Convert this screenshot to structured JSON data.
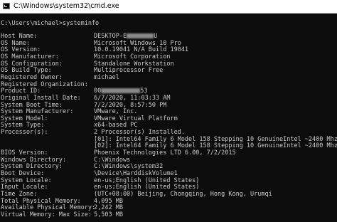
{
  "window": {
    "title": "C:\\Windows\\system32\\cmd.exe",
    "icon": "cmd-app-icon"
  },
  "console": {
    "prompt": "C:\\Users\\michael>systeminfo",
    "rows": [
      {
        "label": "Host Name:",
        "value": "DESKTOP-E",
        "tail": "U",
        "redacted": true
      },
      {
        "label": "OS Name:",
        "value": "Microsoft Windows 10 Pro"
      },
      {
        "label": "OS Version:",
        "value": "10.0.19041 N/A Build 19041"
      },
      {
        "label": "OS Manufacturer:",
        "value": "Microsoft Corporation"
      },
      {
        "label": "OS Configuration:",
        "value": "Standalone Workstation"
      },
      {
        "label": "OS Build Type:",
        "value": "Multiprocessor Free"
      },
      {
        "label": "Registered Owner:",
        "value": "michael"
      },
      {
        "label": "Registered Organization:",
        "value": ""
      },
      {
        "label": "Product ID:",
        "value": "00",
        "tail": "53",
        "redacted": true
      },
      {
        "label": "Original Install Date:",
        "value": "6/7/2020, 11:03:33 AM"
      },
      {
        "label": "System Boot Time:",
        "value": "7/2/2020, 8:57:50 PM"
      },
      {
        "label": "System Manufacturer:",
        "value": "VMware, Inc."
      },
      {
        "label": "System Model:",
        "value": "VMware Virtual Platform"
      },
      {
        "label": "System Type:",
        "value": "x64-based PC"
      },
      {
        "label": "Processor(s):",
        "value": "2 Processor(s) Installed."
      },
      {
        "label": "",
        "value": "[01]: Intel64 Family 6 Model 158 Stepping 10 GenuineIntel ~2400 Mhz"
      },
      {
        "label": "",
        "value": "[02]: Intel64 Family 6 Model 158 Stepping 10 GenuineIntel ~2400 Mhz"
      },
      {
        "label": "BIOS Version:",
        "value": "Phoenix Technologies LTD 6.00, 7/2/2015"
      },
      {
        "label": "Windows Directory:",
        "value": "C:\\Windows"
      },
      {
        "label": "System Directory:",
        "value": "C:\\Windows\\system32"
      },
      {
        "label": "Boot Device:",
        "value": "\\Device\\HarddiskVolume1"
      },
      {
        "label": "System Locale:",
        "value": "en-us;English (United States)"
      },
      {
        "label": "Input Locale:",
        "value": "en-us;English (United States)"
      },
      {
        "label": "Time Zone:",
        "value": "(UTC+08:00) Beijing, Chongqing, Hong Kong, Urumqi"
      },
      {
        "label": "Total Physical Memory:",
        "value": "4,095 MB"
      },
      {
        "label": "Available Physical Memory:",
        "value": "2,242 MB"
      },
      {
        "label": "Virtual Memory: Max Size:",
        "value": "5,503 MB"
      }
    ]
  }
}
